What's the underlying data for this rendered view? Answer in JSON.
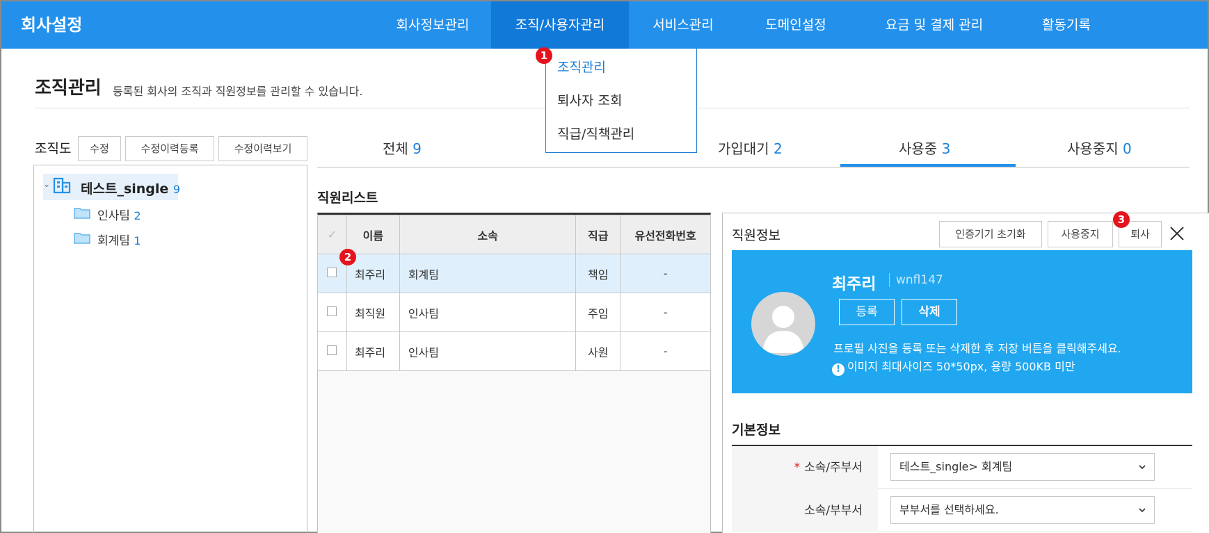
{
  "app": {
    "title": "회사설정"
  },
  "nav": {
    "items": [
      "회사정보관리",
      "조직/사용자관리",
      "서비스관리",
      "도메인설정",
      "요금 및 결제 관리",
      "활동기록"
    ],
    "active_index": 1
  },
  "dropdown": {
    "items": [
      "조직관리",
      "퇴사자 조회",
      "직급/직책관리"
    ],
    "selected_index": 0
  },
  "markers": [
    "1",
    "2",
    "3"
  ],
  "page": {
    "title": "조직관리",
    "description": "등록된 회사의 조직과 직원정보를 관리할 수 있습니다."
  },
  "org": {
    "label": "조직도",
    "buttons": [
      "수정",
      "수정이력등록",
      "수정이력보기"
    ],
    "root": {
      "name": "테스트_single",
      "count": "9"
    },
    "children": [
      {
        "name": "인사팀",
        "count": "2"
      },
      {
        "name": "회계팀",
        "count": "1"
      }
    ]
  },
  "tabs": [
    {
      "label": "전체",
      "count": "9"
    },
    {
      "label": "가입대기",
      "count": "2"
    },
    {
      "label": "사용중",
      "count": "3"
    },
    {
      "label": "사용중지",
      "count": "0"
    }
  ],
  "active_tab_index": 2,
  "list": {
    "title": "직원리스트",
    "columns": [
      "✓",
      "이름",
      "소속",
      "직급",
      "유선전화번호"
    ],
    "rows": [
      {
        "name": "최주리",
        "dept": "회계팀",
        "rank": "책임",
        "phone": "-"
      },
      {
        "name": "최직원",
        "dept": "인사팀",
        "rank": "주임",
        "phone": "-"
      },
      {
        "name": "최주리",
        "dept": "인사팀",
        "rank": "사원",
        "phone": "-"
      }
    ],
    "selected_row_index": 0
  },
  "detail": {
    "title": "직원정보",
    "buttons": [
      "인증기기 초기화",
      "사용중지",
      "퇴사"
    ],
    "profile": {
      "name": "최주리",
      "user_id": "wnfl147",
      "register_label": "등록",
      "delete_label": "삭제",
      "help": "프로필 사진을 등록 또는 삭제한 후 저장 버튼을 클릭해주세요.",
      "warning": "이미지 최대사이즈 50*50px, 용량 500KB 미만"
    },
    "basic": {
      "title": "기본정보",
      "fields": [
        {
          "label": "소속/주부서",
          "required": "*",
          "value": "테스트_single> 회계팀"
        },
        {
          "label": "소속/부부서",
          "required": "",
          "value": "부부서를 선택하세요."
        }
      ]
    }
  },
  "colors": {
    "primary": "#2391ec",
    "active_nav": "#1179d8",
    "profile_bg": "#20a7f0",
    "marker": "#e5131d",
    "link": "#1a7fdb"
  }
}
